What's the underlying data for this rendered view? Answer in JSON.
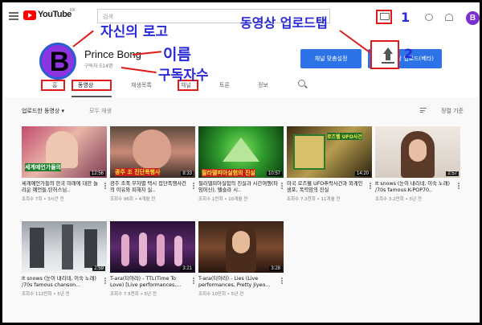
{
  "topbar": {
    "logo_text": "YouTube",
    "logo_region": "KR",
    "search_placeholder": "검색",
    "avatar_letter": "B"
  },
  "channel": {
    "avatar_letter": "B",
    "name": "Prince Bong",
    "subscribers": "구독자 514명",
    "customize_button": "채널 맞춤설정",
    "upload_button": "동영상 업로드(베타)"
  },
  "tabs": [
    {
      "label": "홈"
    },
    {
      "label": "동영상"
    },
    {
      "label": "재생목록"
    },
    {
      "label": "채널"
    },
    {
      "label": "토론"
    },
    {
      "label": "정보"
    }
  ],
  "filter": {
    "main": "업로드한 동영상 ▾",
    "all": "모두 재생",
    "sort": "정렬 기준"
  },
  "videos": [
    {
      "title": "세계예언가들의 한국 미래에 대한 놀라운 예언들,탄허스님..",
      "meta": "조회수 7회 • 3시간 전",
      "duration": "12:56",
      "overlay": "세계예언가들의"
    },
    {
      "title": "광주 조폭 무차별 택시 집단폭행사건의 이유와 피해자 실..",
      "meta": "조회수 96회 • 4개월 전",
      "duration": "8:33",
      "overlay": "광주 조 진단폭행사"
    },
    {
      "title": "필라델피아실험의 진실과 시간여행(타임머신), 텔슬라 시..",
      "meta": "조회수 1만회 • 10개월 전",
      "duration": "10:57",
      "overlay": "필라델피아실험의 진실"
    },
    {
      "title": "미국 로즈웰 UFO추락사건과 외계인 생포, 폭력암의 진실",
      "meta": "조회수 7.3천회 • 11개월 전",
      "duration": "14:20",
      "overlay": "로즈웰 UFO사건"
    },
    {
      "title": "It snows (눈이 내리네, 이숙 노래) /70s famous K-POP70..",
      "meta": "조회수 3.2만회 • 5년 전",
      "duration": "2:57",
      "overlay": ""
    },
    {
      "title": "It snows (눈이 내리네, 이숙 노래) /70s famous chanson...",
      "meta": "조회수 112만회 • 5년 전",
      "duration": "2:59",
      "overlay": ""
    },
    {
      "title": "T-ara(티아라) - TTL(Time To Love) [Live performances,...",
      "meta": "조회수 7.5천회 • 5년 전",
      "duration": "3:21",
      "overlay": ""
    },
    {
      "title": "T-ara(티아라) - Lies (Live performances, Pretty Jiyeo...",
      "meta": "조회수 10만회 • 5년 전",
      "duration": "3:28",
      "overlay": ""
    }
  ],
  "annotations": {
    "logo_label": "자신의 로고",
    "name_label": "이름",
    "subs_label": "구독자수",
    "upload_tab_label": "동영상 업로드탭",
    "num1": "1",
    "num2": "2"
  },
  "colors": {
    "accent": "#2b73e6",
    "annotation_text": "#2929d6",
    "annotation_box": "#e01a1a",
    "avatar": "#8c34e0"
  }
}
